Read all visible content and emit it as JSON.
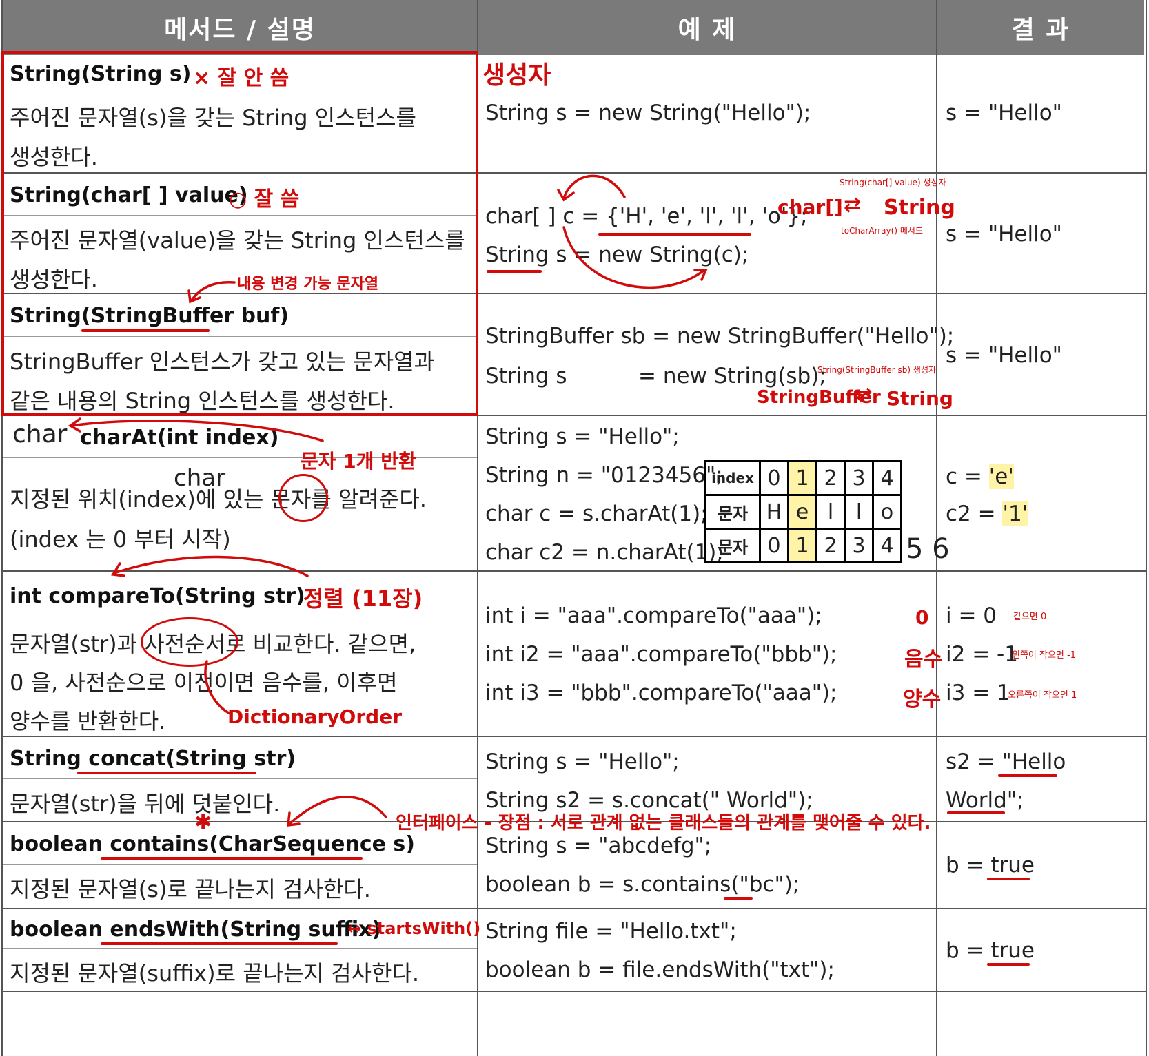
{
  "header": {
    "col1": "메서드 / 설명",
    "col2": "예 제",
    "col3": "결 과"
  },
  "rows": [
    {
      "sig": "String(String s)",
      "note": "× 잘 안 씀",
      "desc1": "주어진 문자열(s)을 갖는 String 인스턴스를",
      "desc2": "생성한다.",
      "ann": "생성자",
      "code1": "String s = new String(\"Hello\");",
      "res1": "s = \"Hello\""
    },
    {
      "sig": "String(char[ ] value)",
      "note": "○ 잘 씀",
      "desc1": "주어진 문자열(value)을 갖는 String 인스턴스를",
      "desc2": "생성한다.",
      "code1": "char[ ] c = {'H', 'e', 'l', 'l', 'o'};",
      "code2": "String s = new String(c);",
      "res1": "s = \"Hello\"",
      "ann1": "String(char[] value) 생성자",
      "ann2": "char[]",
      "ann3": "String",
      "ann4": "toCharArray() 메서드"
    },
    {
      "sig": "String(StringBuffer buf)",
      "note": "내용 변경 가능 문자열",
      "desc1": "StringBuffer 인스턴스가 갖고 있는 문자열과",
      "desc2": "같은 내용의 String 인스턴스를 생성한다.",
      "code1": "StringBuffer sb = new StringBuffer(\"Hello\");",
      "code2a": "String s",
      "code2b": "= new String(sb);",
      "res1": "s = \"Hello\"",
      "ann1": "String(StringBuffer sb) 생성자",
      "ann2": "StringBuffer",
      "ann3": "String"
    },
    {
      "sig_ret": "char",
      "sig": "charAt(int index)",
      "note": "문자 1개 반환",
      "desc1": "지정된 위치(index)에 있는 문자를 알려준다.",
      "desc2": "(index 는 0 부터 시작)",
      "desc_ann": "char",
      "code1": "String s = \"Hello\";",
      "code2": "String n = \"0123456\";",
      "code3": "char c   = s.charAt(1);",
      "code4": "char c2  = n.charAt(1);",
      "res1a": "c   = ",
      "res1b": "'e'",
      "res2a": "c2 = ",
      "res2b": "'1'",
      "grid": {
        "h0": "index",
        "h1": "문자",
        "h2": "문자",
        "idx": [
          "0",
          "1",
          "2",
          "3",
          "4"
        ],
        "chars": [
          "H",
          "e",
          "l",
          "l",
          "o"
        ],
        "digits": [
          "0",
          "1",
          "2",
          "3",
          "4"
        ],
        "extra": "5 6"
      }
    },
    {
      "sig": "int compareTo(String str)",
      "note": "정렬 (11장)",
      "desc1": "문자열(str)과 사전순서로 비교한다. 같으면,",
      "desc2": "0 을, 사전순으로 이전이면 음수를, 이후면",
      "desc3": "양수를 반환한다.",
      "desc_ann": "DictionaryOrder",
      "code1": "int i   = \"aaa\".compareTo(\"aaa\");",
      "code2": "int i2  = \"aaa\".compareTo(\"bbb\");",
      "code3": "int i3  = \"bbb\".compareTo(\"aaa\");",
      "m1": "0",
      "m2": "음수",
      "m3": "양수",
      "res1": "i   = 0",
      "res2": "i2 = -1",
      "res3": "i3 = 1",
      "rn1": "같으면 0",
      "rn2": "왼쪽이 작으면 -1",
      "rn3": "오른쪽이 작으면 1"
    },
    {
      "sig": "String concat(String str)",
      "desc1": "문자열(str)을 뒤에 덧붙인다.",
      "code1": "String s   = \"Hello\";",
      "code2": "String s2 = s.concat(\" World\");",
      "res1": "s2 = \"Hello",
      "res2": "World\";"
    },
    {
      "sig": "boolean contains(CharSequence s)",
      "note": "인터페이스 - 장점 : 서로 관계 없는 클래스들의 관계를 맺어줄 수 있다.",
      "desc1": "지정된 문자열(s)로 끝나는지 검사한다.",
      "code1": "String s = \"abcdefg\";",
      "code2": "boolean b = s.contains(\"bc\");",
      "res1": "b = true"
    },
    {
      "sig": "boolean endsWith(String suffix)",
      "note": "↔ startsWith()",
      "desc1": "지정된 문자열(suffix)로 끝나는지 검사한다.",
      "code1": "String file = \"Hello.txt\";",
      "code2": "boolean b = file.endsWith(\"txt\");",
      "res1": "b = true"
    }
  ]
}
